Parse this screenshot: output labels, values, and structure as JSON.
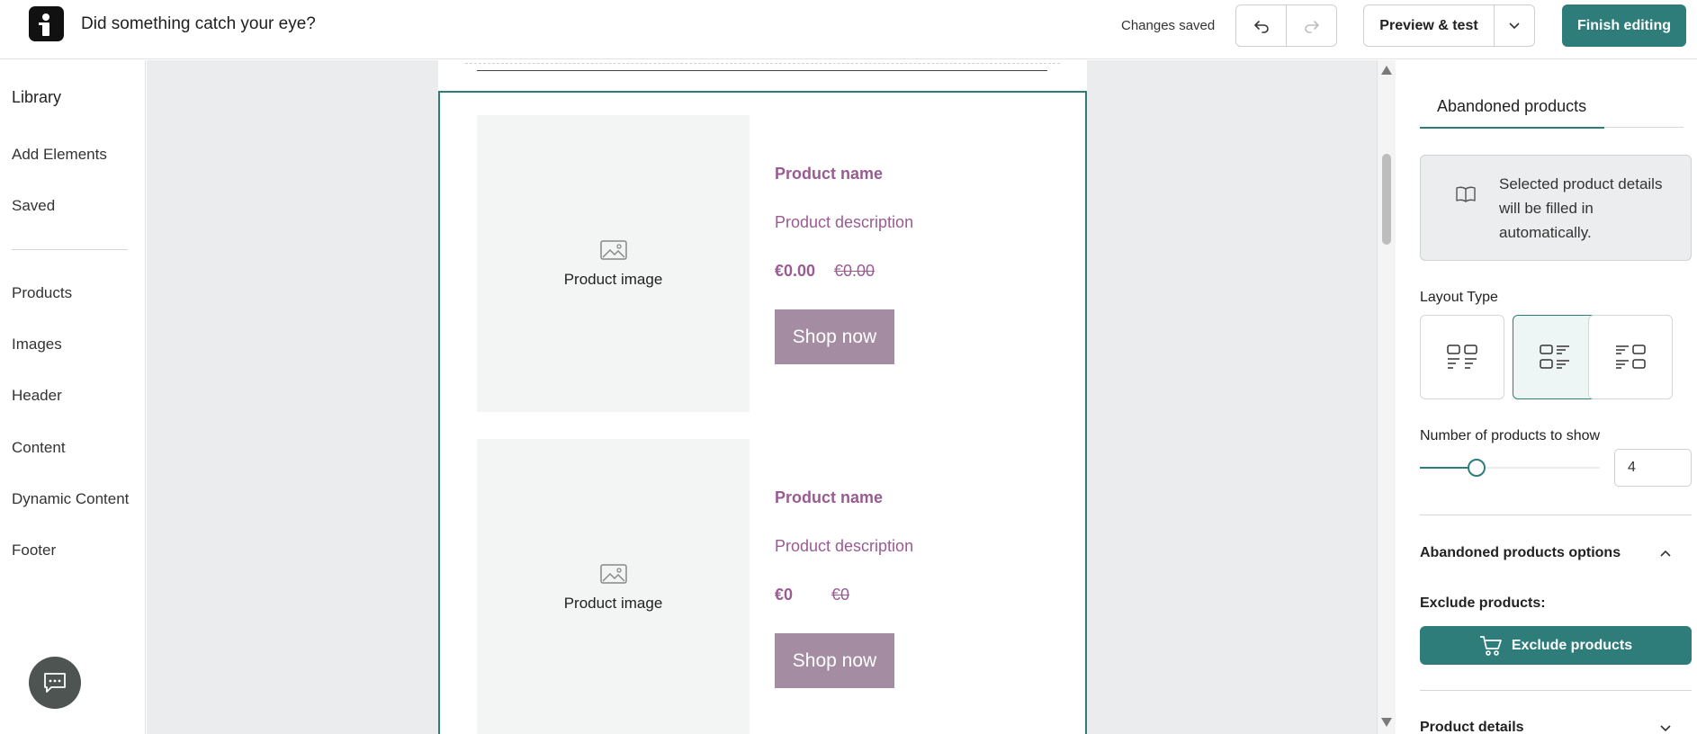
{
  "header": {
    "title": "Did something catch your eye?",
    "status": "Changes saved",
    "preview_label": "Preview & test",
    "finish_label": "Finish editing"
  },
  "sidebar": {
    "heading": "Library",
    "items": [
      {
        "label": "Add Elements"
      },
      {
        "label": "Saved"
      },
      {
        "label": "Products"
      },
      {
        "label": "Images"
      },
      {
        "label": "Header"
      },
      {
        "label": "Content"
      },
      {
        "label": "Dynamic Content"
      },
      {
        "label": "Footer"
      }
    ]
  },
  "canvas": {
    "products": [
      {
        "image_label": "Product image",
        "name": "Product name",
        "description": "Product description",
        "price": "€0.00",
        "old_price": "€0.00",
        "button": "Shop now"
      },
      {
        "image_label": "Product image",
        "name": "Product name",
        "description": "Product description",
        "price": "€0",
        "old_price": "€0",
        "button": "Shop now"
      }
    ]
  },
  "panel": {
    "tab": "Abandoned products",
    "info": "Selected product details will be filled in automatically.",
    "layout_type_label": "Layout Type",
    "layout_options": [
      {
        "icon": "layout-grid-icon",
        "selected": false
      },
      {
        "icon": "layout-list-icon",
        "selected": true
      },
      {
        "icon": "layout-alternate-icon",
        "selected": false
      }
    ],
    "count_label": "Number of products to show",
    "count_value": "4",
    "options_section": "Abandoned products options",
    "exclude_label": "Exclude products:",
    "exclude_button": "Exclude products",
    "details_section": "Product details"
  },
  "colors": {
    "accent": "#2e7d7a",
    "product_text": "#9a5b91",
    "shop_button": "#a48da2"
  }
}
